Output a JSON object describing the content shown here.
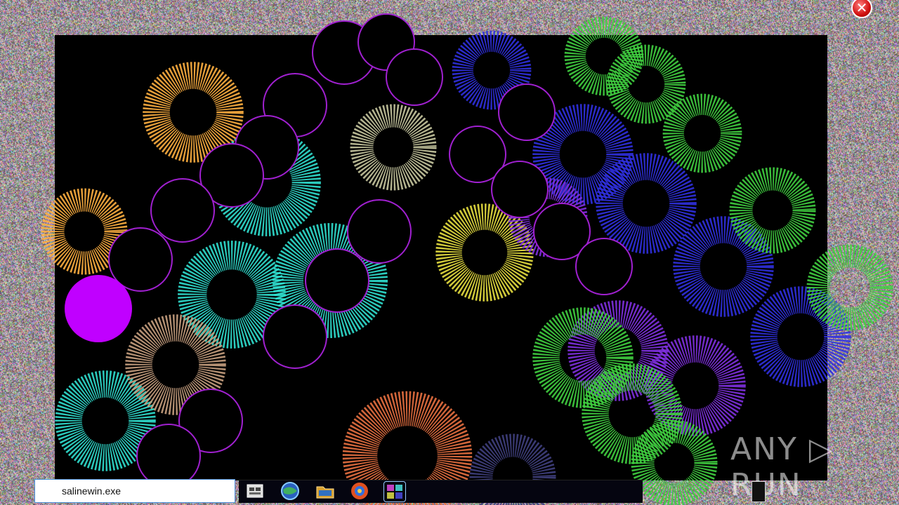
{
  "taskbar": {
    "search_value": "salinewin.exe",
    "icons": [
      "file-manager-icon",
      "globe-icon",
      "folder-icon",
      "browser-icon",
      "app-grid-icon"
    ]
  },
  "window": {
    "close_label": "✕"
  },
  "watermark": {
    "text": "ANY ▷ RUN"
  },
  "colors": {
    "magenta": "#c000ff",
    "orange": "#ffb040",
    "cyan": "#30e0d0",
    "green": "#40d040",
    "blue": "#3030e0",
    "purple": "#8030e0",
    "yellow": "#e8e040"
  }
}
